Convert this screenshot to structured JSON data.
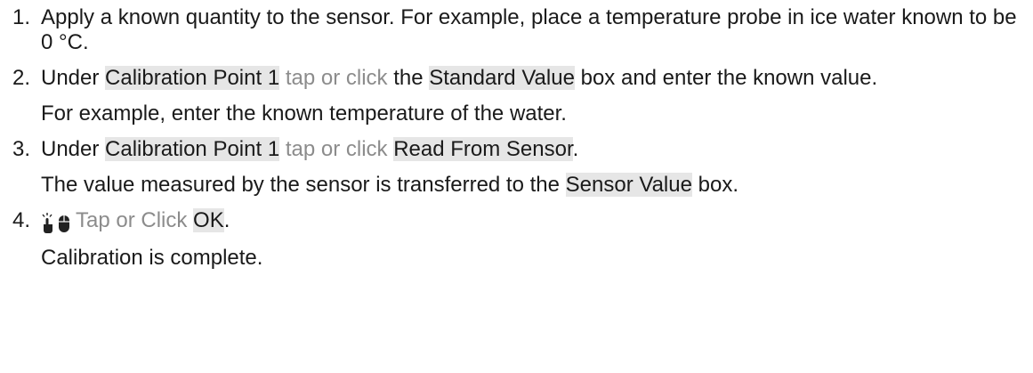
{
  "steps": [
    {
      "number": "1.",
      "text": "Apply a known quantity to the sensor. For example, place a temperature probe in ice water known to be 0 °C."
    },
    {
      "number": "2.",
      "pre": "Under ",
      "target1": "Calibration Point 1",
      "action": " tap or click",
      "mid": " the ",
      "target2": "Standard Value",
      "post": " box and enter the known value.",
      "note": "For example, enter the known temperature of the water."
    },
    {
      "number": "3.",
      "pre": "Under ",
      "target1": "Calibration Point 1",
      "action": " tap or click",
      "mid": " ",
      "target2": "Read From Sensor",
      "post": ".",
      "note_pre": "The value measured by the sensor is transferred to the ",
      "note_target": "Sensor Value",
      "note_post": " box."
    },
    {
      "number": "4.",
      "icons": [
        "tap-hand-icon",
        "mouse-icon"
      ],
      "action": "Tap or Click",
      "sep": " ",
      "target": "OK",
      "post": ".",
      "note": "Calibration is complete."
    }
  ]
}
